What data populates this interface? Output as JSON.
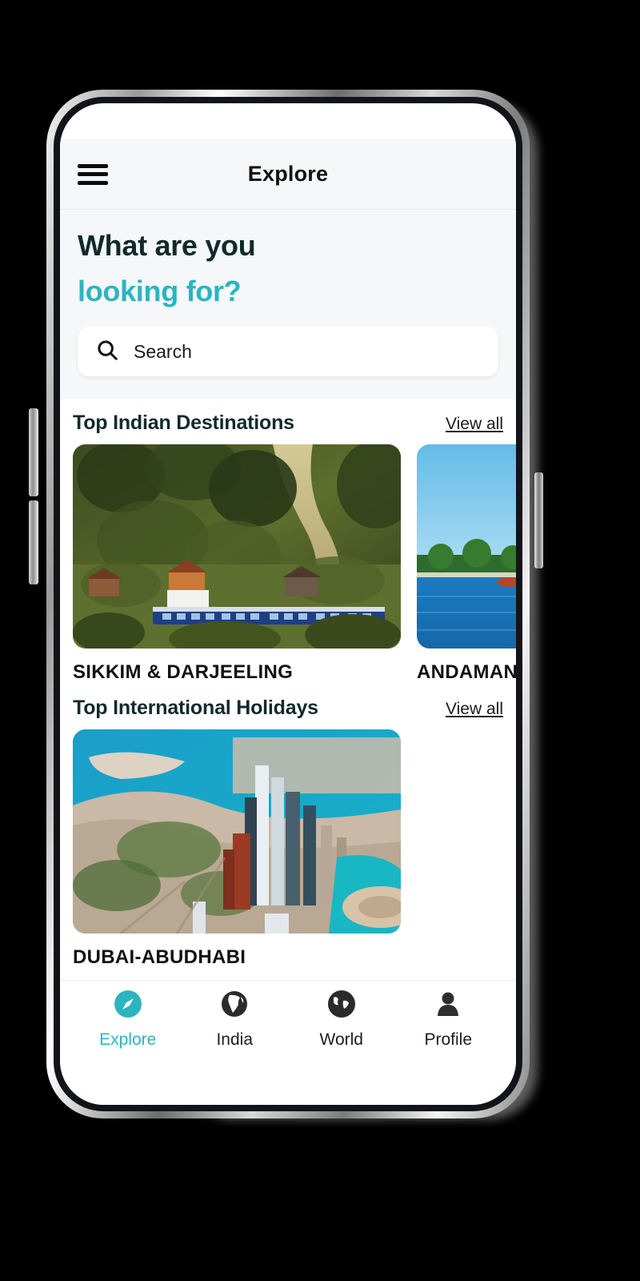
{
  "app": {
    "title": "Explore",
    "menu_icon": "hamburger-menu-icon"
  },
  "hero": {
    "line1": "What are you",
    "line2": "looking for?",
    "accent_color": "#2bb5c0",
    "heading_color": "#102a2b"
  },
  "search": {
    "placeholder": "Search",
    "value": "",
    "icon": "search-icon"
  },
  "sections": [
    {
      "title": "Top Indian Destinations",
      "view_all_label": "View all",
      "cards": [
        {
          "label": "SIKKIM & DARJEELING",
          "image": "hill-forest-village-toy-train-photo"
        },
        {
          "label": "ANDAMAN",
          "image": "tropical-island-palm-beach-sea-photo"
        }
      ]
    },
    {
      "title": "Top International Holidays",
      "view_all_label": "View all",
      "cards": [
        {
          "label": "DUBAI-ABUDHABI",
          "image": "abu-dhabi-skyline-aerial-coast-photo"
        }
      ]
    }
  ],
  "bottom_nav": {
    "items": [
      {
        "label": "Explore",
        "icon": "compass-icon",
        "active": true
      },
      {
        "label": "India",
        "icon": "globe-india-icon",
        "active": false
      },
      {
        "label": "World",
        "icon": "globe-world-icon",
        "active": false
      },
      {
        "label": "Profile",
        "icon": "person-icon",
        "active": false
      }
    ]
  }
}
